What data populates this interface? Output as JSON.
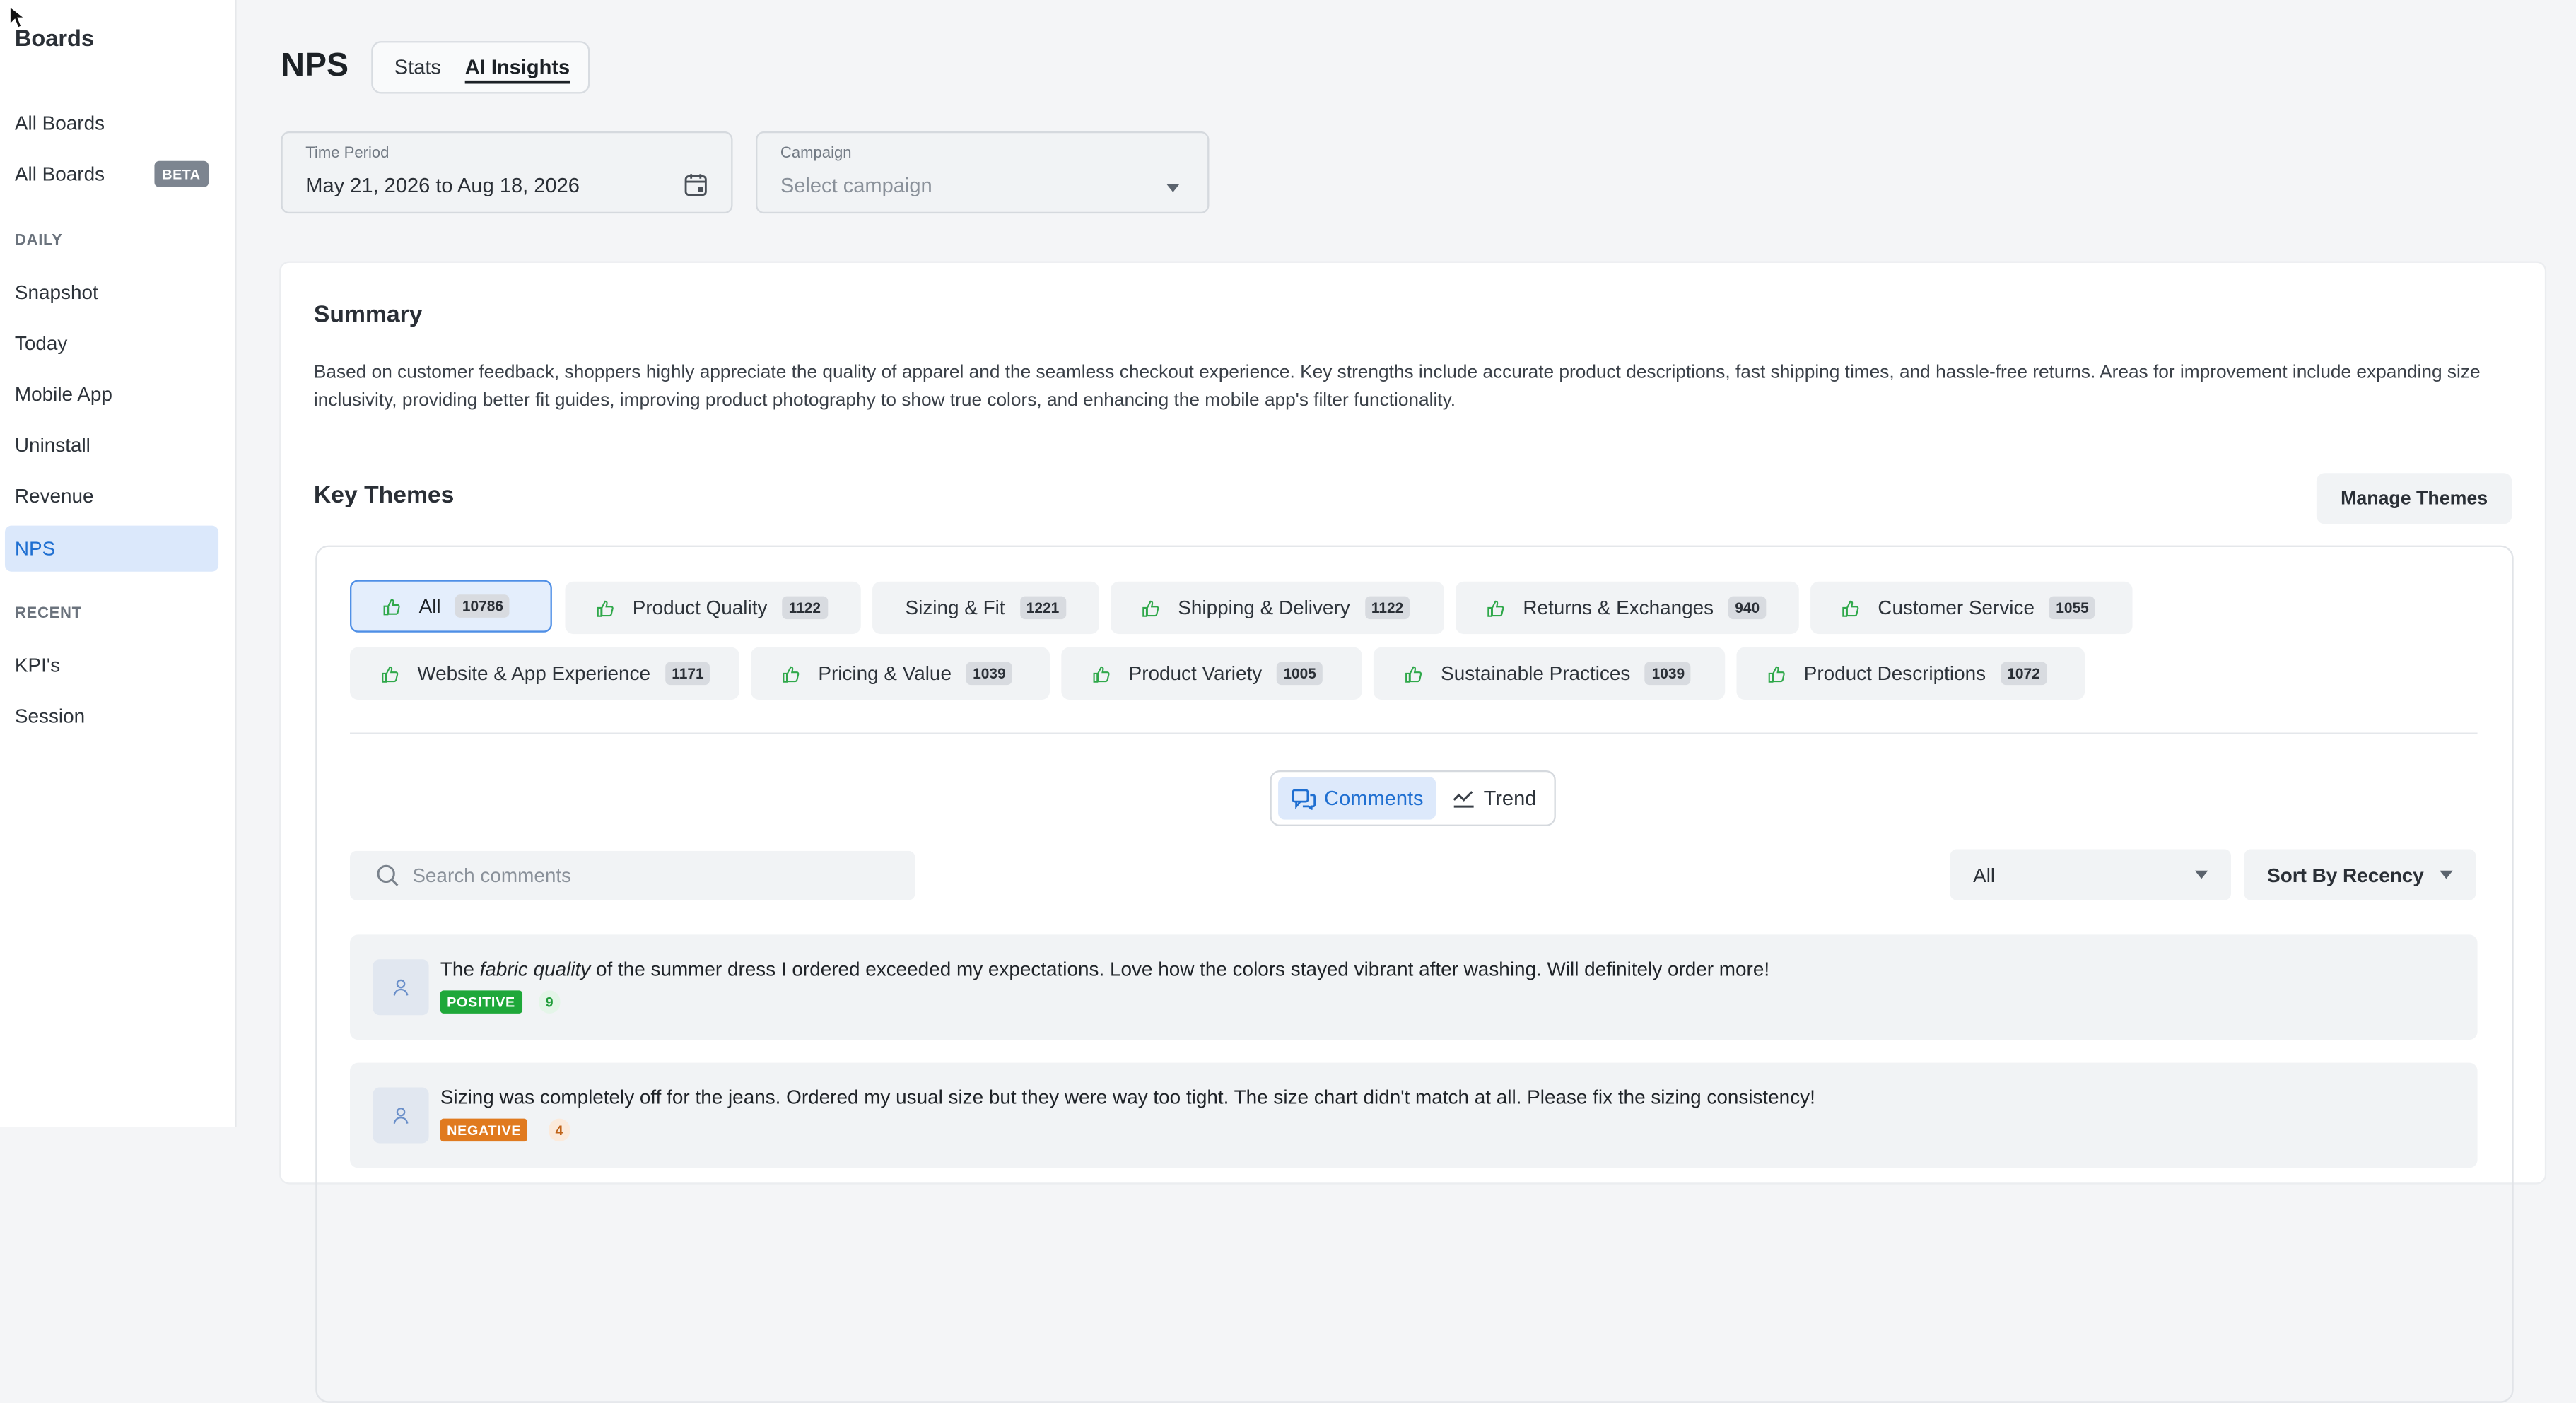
{
  "sidebar": {
    "title": "Boards",
    "items": [
      {
        "label": "All Boards"
      },
      {
        "label": "All Boards",
        "badge": "BETA"
      }
    ],
    "daily_heading": "DAILY",
    "daily": [
      {
        "label": "Snapshot"
      },
      {
        "label": "Today"
      },
      {
        "label": "Mobile App"
      },
      {
        "label": "Uninstall"
      },
      {
        "label": "Revenue"
      },
      {
        "label": "NPS",
        "active": true
      }
    ],
    "recent_heading": "RECENT",
    "recent": [
      {
        "label": "KPI's"
      },
      {
        "label": "Session"
      }
    ]
  },
  "header": {
    "title": "NPS",
    "tabs": [
      {
        "label": "Stats"
      },
      {
        "label": "AI Insights",
        "active": true
      }
    ]
  },
  "filters": {
    "time_period": {
      "label": "Time Period",
      "value": "May 21, 2026 to Aug 18, 2026"
    },
    "campaign": {
      "label": "Campaign",
      "placeholder": "Select campaign"
    }
  },
  "summary": {
    "heading": "Summary",
    "text": "Based on customer feedback, shoppers highly appreciate the quality of apparel and the seamless checkout experience. Key strengths include accurate product descriptions, fast shipping times, and hassle-free returns. Areas for improvement include expanding size inclusivity, providing better fit guides, improving product photography to show true colors, and enhancing the mobile app's filter functionality."
  },
  "themes": {
    "heading": "Key Themes",
    "manage_label": "Manage Themes",
    "chips": [
      {
        "label": "All",
        "count": "10786",
        "icon": "thumbs-up-icon"
      },
      {
        "label": "Product Quality",
        "count": "1122",
        "icon": "thumbs-up-icon"
      },
      {
        "label": "Sizing & Fit",
        "count": "1221",
        "icon": ""
      },
      {
        "label": "Shipping & Delivery",
        "count": "1122",
        "icon": "thumbs-up-icon"
      },
      {
        "label": "Returns & Exchanges",
        "count": "940",
        "icon": "thumbs-up-icon"
      },
      {
        "label": "Customer Service",
        "count": "1055",
        "icon": "thumbs-up-icon"
      },
      {
        "label": "Website & App Experience",
        "count": "1171",
        "icon": "thumbs-up-icon"
      },
      {
        "label": "Pricing & Value",
        "count": "1039",
        "icon": "thumbs-up-icon"
      },
      {
        "label": "Product Variety",
        "count": "1005",
        "icon": "thumbs-up-icon"
      },
      {
        "label": "Sustainable Practices",
        "count": "1039",
        "icon": "thumbs-up-icon"
      },
      {
        "label": "Product Descriptions",
        "count": "1072",
        "icon": "thumbs-up-icon"
      }
    ]
  },
  "view_toggle": {
    "comments": "Comments",
    "trend": "Trend"
  },
  "search": {
    "placeholder": "Search comments"
  },
  "filter_select": {
    "value": "All"
  },
  "sort_select": {
    "value": "Sort By Recency"
  },
  "comments": [
    {
      "pre": "The ",
      "em": "fabric quality",
      "post": " of the summer dress I ordered exceeded my expectations. Love how the colors stayed vibrant after washing. Will definitely order more!",
      "sentiment": "POSITIVE",
      "score": "9"
    },
    {
      "text": "Sizing was completely off for the jeans. Ordered my usual size but they were way too tight. The size chart didn't match at all. Please fix the sizing consistency!",
      "sentiment": "NEGATIVE",
      "score": "4"
    }
  ],
  "colors": {
    "accent": "#1f6fd1",
    "positive": "#1fa83a",
    "negative": "#e07a1f"
  }
}
